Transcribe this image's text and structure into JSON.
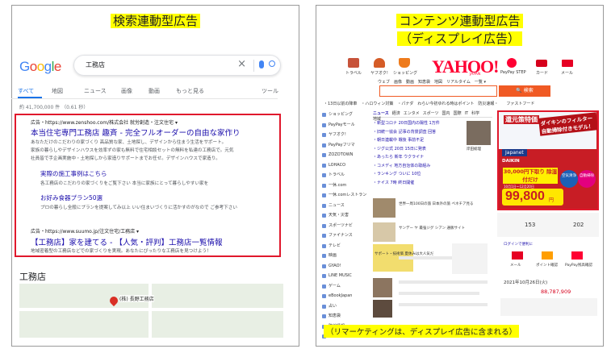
{
  "left": {
    "title": "検索連動型広告",
    "search_query": "工務店",
    "tabs": [
      "すべて",
      "地図",
      "ニュース",
      "画像",
      "動画",
      "もっと見る",
      "ツール"
    ],
    "result_count": "約 41,700,000 件 （0.61 秒）",
    "ad1_meta": "広告・https://www.zenshoo.com/株式会社 就労創造・注文住宅 ▾",
    "ad1_title": "本当住宅専門工務店 趣斉 - 完全フルオーダーの自由な家作り",
    "ad1_desc1": "あなただけのこだわりの家づくり 高品質な家、土地探し、デザインから住まう生活をサポート。",
    "ad1_desc2": "家族の暮らしやデザインハウスを効率ずの家も無料で住宅相談セットの無料を私達の工務店で。元気",
    "ad1_desc3": "社員皆で手企画実施中・土地探しから家造りサポートまでお任せ。デザインハウスで家造り。",
    "ad1_sub1_title": "実際の施工事例はこちら",
    "ad1_sub1_desc": "各工務店のこだわりの家づくりをご覧下さい 本当に家族にとって暮らしやすい家を",
    "ad1_sub2_title": "お好み食器プラン50選",
    "ad1_sub2_desc": "プロの暮らし全般にプランを提案してみ以上 いい住まいづくりに活かすのがなので ご参考下さい",
    "ad2_meta": "広告・https://www.suumo.jp/注文住宅/工務店 ▾",
    "ad2_title": "【工務店】家を建てる - 【人気・評判】工務店一覧情報",
    "ad2_desc": "地域密着型の工務店などでの家づくりを実現。あなたにぴったりな工務店を見つけよう！",
    "local_title": "工務店",
    "map_label": "(株) 長野工務店"
  },
  "right": {
    "title_line1": "コンテンツ連動型広告",
    "title_line2": "（ディスプレイ広告）",
    "nav_icons": [
      "トラベル",
      "ヤフオク!",
      "ショッピング",
      "PayPay STEP",
      "カード",
      "メール"
    ],
    "logo": "YAHOO!",
    "logo_sub": "JAPAN",
    "search_tabs": "ウェブ　画像　動画　知恵袋　地図　リアルタイム　一覧 ▾",
    "search_button": "検索",
    "topics": "・13日以前の降車　・ハロウィン対策　・パナダ　わらい今初ゆれる時はポイント　防災速報・　　ファストフード",
    "sidebar": [
      "ショッピング",
      "PayPayモール",
      "ヤフオク!",
      "PayPayフリマ",
      "ZOZOTOWN",
      "LOHACO",
      "トラベル",
      "一休.com",
      "一休.comレストラン",
      "ニュース",
      "天気・災害",
      "スポーツナビ",
      "ファイナンス",
      "テレビ",
      "映画",
      "GYAO!",
      "LINE MUSIC",
      "ゲーム",
      "eBookJapan",
      "占い",
      "知恵袋",
      "路線情報",
      "Retty"
    ],
    "news_tabs": [
      "ニュース",
      "経済",
      "エンタメ",
      "スポーツ",
      "国内",
      "国際",
      "IT",
      "科学",
      "地域"
    ],
    "news_items": [
      "・新型コロナ 20日国内の陽性 1万件",
      "・旧統一協会 記事の背景調査 回答",
      "・朝日連載中 戦後 事前不足",
      "・ジグ公式 20日 15日に発表",
      "・あったら 新年 ウクライナ",
      "・コメディ 地方自治体の取組み",
      "・ランキング ついに 10位",
      "・ナイス 7時 終日開催"
    ],
    "news_photo_caption": "岸田総理",
    "feature_caption": "世界一周100日の旅 日本外の旅 ペネチア見る",
    "feature2_caption": "サンデー ヤ 最強ジグ シアン 通販サイト",
    "promo_caption": "サポート・技術価 夏休みは大人気だ",
    "weather_value": "153",
    "points_value": "202",
    "login_prompt": "ログインで便利に",
    "account_labels": [
      "メール",
      "ポイント確認",
      "PayPay残高確認"
    ],
    "date_text": "2021年10月26日(火)",
    "counter_value": "88,787,909",
    "remark": "（リマーケティングは、ディスプレイ広告に含まれる）",
    "ad_text": {
      "headline": "還元策特価",
      "catch": "ダイキンのフィルター自動掃除付きモデル！",
      "brand": "Japanet",
      "maker": "DAIKIN",
      "offer": "30,000円下取り 除湿付だけ",
      "coupon": "10月1日〜12月20日",
      "price": "99,800",
      "price_unit": "円",
      "badge1": "空気清浄",
      "badge2": "自動掃除"
    }
  }
}
